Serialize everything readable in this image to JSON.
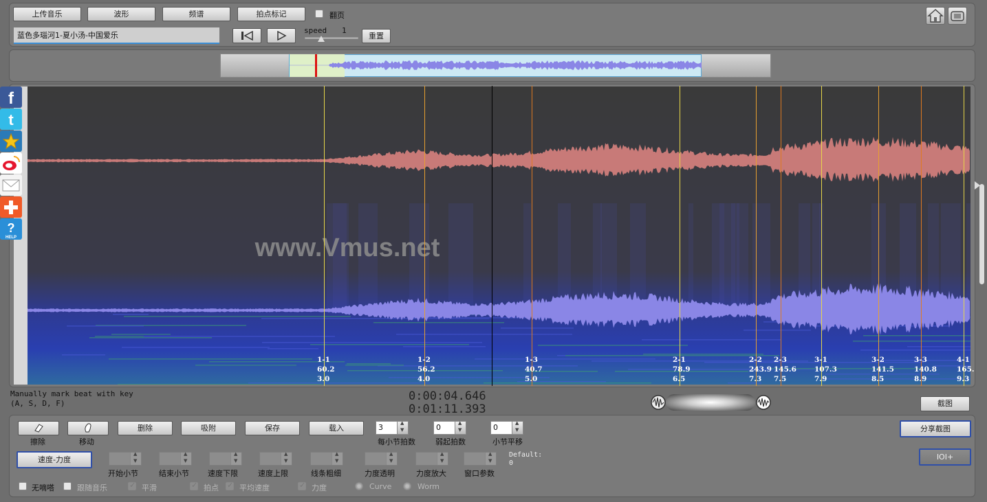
{
  "toolbar": {
    "upload_label": "上传音乐",
    "waveform_label": "波形",
    "spectrum_label": "频谱",
    "beat_mark_label": "拍点标记",
    "flip_label": "翻页",
    "song_title": "蓝色多瑙河1-夏小汤-中国爱乐",
    "speed_label": "speed",
    "speed_value": "1",
    "reset_label": "重置"
  },
  "viz": {
    "watermark": "www.Vmus.net",
    "markers": [
      {
        "bar": "1-1",
        "tempo": "60.2",
        "time": "3.0",
        "color": "#e8d84a"
      },
      {
        "bar": "1-2",
        "tempo": "56.2",
        "time": "4.0",
        "color": "#e8a030"
      },
      {
        "bar": "1-3",
        "tempo": "40.7",
        "time": "5.0",
        "color": "#e07a20"
      },
      {
        "bar": "2-1",
        "tempo": "78.9",
        "time": "6.5",
        "color": "#e8d84a"
      },
      {
        "bar": "2-2",
        "tempo": "243.9",
        "time": "7.3",
        "color": "#e8a030"
      },
      {
        "bar": "2-3",
        "tempo": "145.6",
        "time": "7.5",
        "color": "#e07a20"
      },
      {
        "bar": "3-1",
        "tempo": "107.3",
        "time": "7.9",
        "color": "#e8d84a"
      },
      {
        "bar": "3-2",
        "tempo": "141.5",
        "time": "8.5",
        "color": "#e8a030"
      },
      {
        "bar": "3-3",
        "tempo": "140.8",
        "time": "8.9",
        "color": "#e07a20"
      },
      {
        "bar": "4-1",
        "tempo": "165.",
        "time": "9.3",
        "color": "#e8d84a"
      }
    ]
  },
  "status": {
    "hint_line1": "Manually mark beat with key",
    "hint_line2": "(A, S, D, F)",
    "current_time": "0:00:04.646",
    "total_time": "0:01:11.393",
    "screenshot_label": "截图"
  },
  "controls": {
    "erase_label": "擦除",
    "move_label": "移动",
    "delete_label": "删除",
    "snap_label": "吸附",
    "save_label": "保存",
    "load_label": "载入",
    "beats_per_bar_value": "3",
    "beats_per_bar_label": "每小节拍数",
    "pickup_value": "0",
    "pickup_label": "弱起拍数",
    "bar_shift_value": "0",
    "bar_shift_label": "小节平移",
    "share_label": "分享截图",
    "speed_force_label": "速度-力度",
    "ioi_label": "IOI+",
    "start_bar_label": "开始小节",
    "end_bar_label": "结束小节",
    "speed_min_label": "速度下限",
    "speed_max_label": "速度上限",
    "line_width_label": "线条粗细",
    "force_alpha_label": "力度透明",
    "force_scale_label": "力度放大",
    "window_param_label": "窗口参数",
    "default_label": "Default:",
    "default_value": "0",
    "no_click_label": "无嘀嗒",
    "follow_music_label": "跟随音乐",
    "smooth_label": "平滑",
    "beat_point_label": "拍点",
    "avg_speed_label": "平均速度",
    "force_label": "力度",
    "curve_label": "Curve",
    "worm_label": "Worm"
  },
  "social": [
    "facebook-icon",
    "twitter-icon",
    "star-icon",
    "weibo-icon",
    "mail-icon",
    "plus-icon",
    "help-icon"
  ],
  "colors": {
    "upper_wave": "#c87a78",
    "lower_wave": "#8a86e6",
    "spectrogram_bg": "#3a3a3a",
    "playhead": "#000000"
  }
}
